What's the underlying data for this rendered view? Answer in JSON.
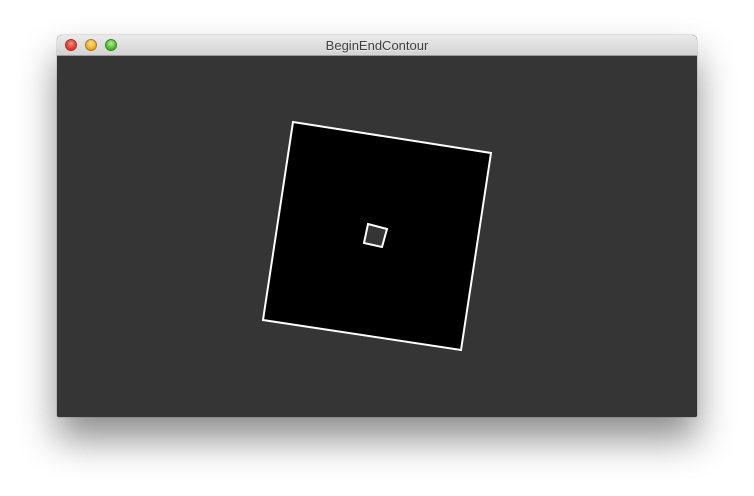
{
  "window": {
    "title": "BeginEndContour",
    "background_color": "#353535",
    "controls": {
      "close": "close-button",
      "minimize": "minimize-button",
      "zoom": "zoom-button"
    }
  },
  "sketch": {
    "shape_fill": "#000000",
    "stroke_color": "#ffffff",
    "outer_contour": "rotated-square",
    "inner_contour": "rotated-square-hole"
  }
}
